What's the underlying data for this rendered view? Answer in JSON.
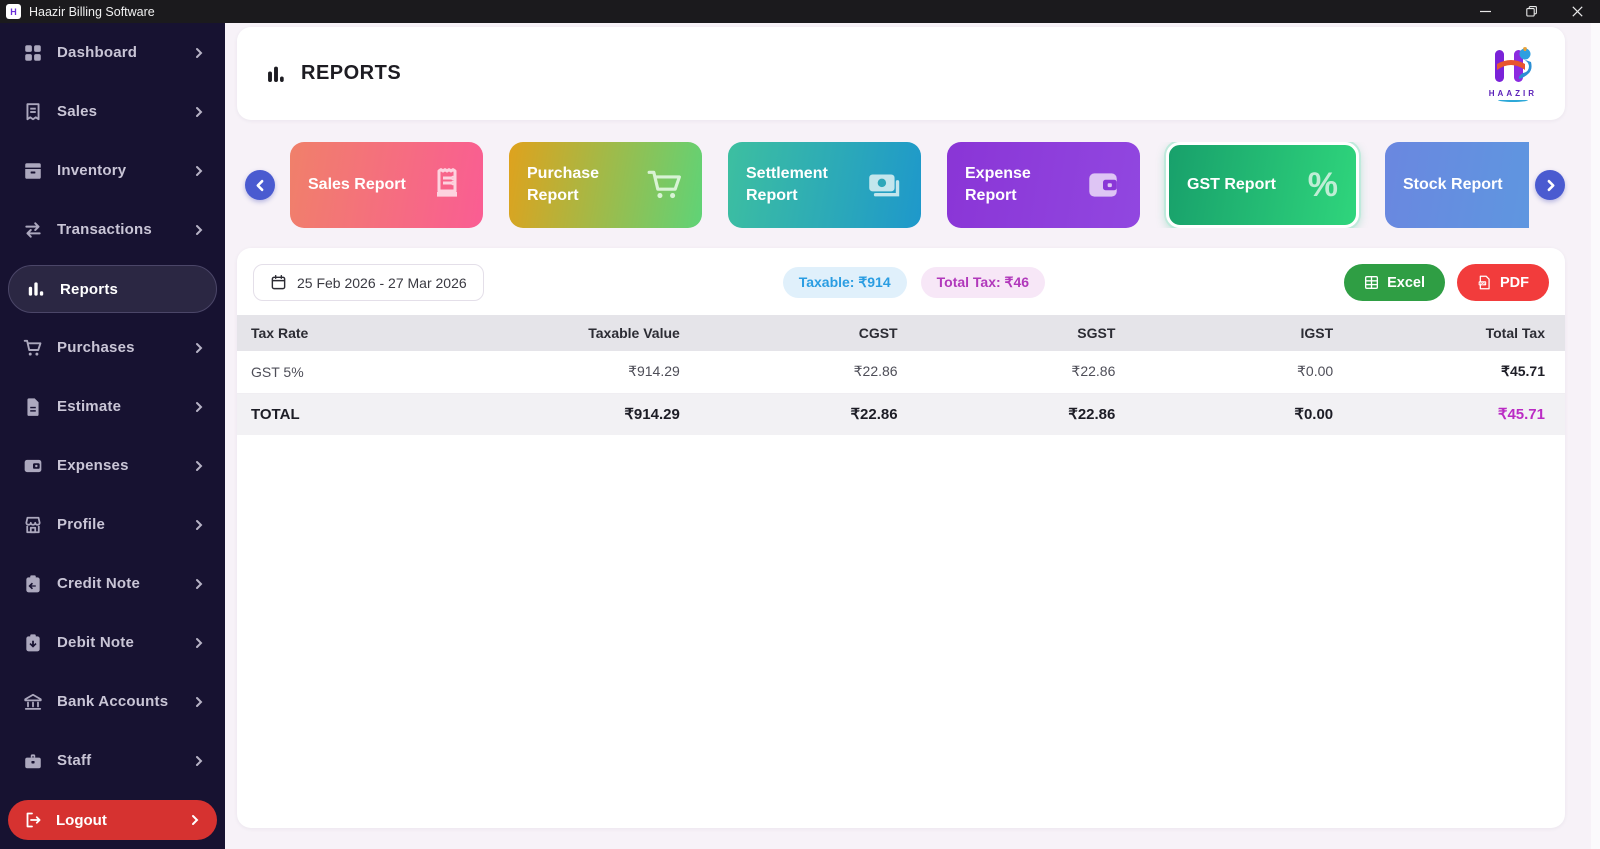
{
  "window": {
    "title": "Haazir Billing Software",
    "controls": {
      "minimize": "minimize",
      "restore": "restore",
      "close": "close"
    }
  },
  "sidebar": {
    "items": [
      {
        "label": "Dashboard",
        "icon": "grid-icon",
        "active": false
      },
      {
        "label": "Sales",
        "icon": "receipt-icon",
        "active": false
      },
      {
        "label": "Inventory",
        "icon": "box-icon",
        "active": false
      },
      {
        "label": "Transactions",
        "icon": "swap-arrows-icon",
        "active": false
      },
      {
        "label": "Reports",
        "icon": "bar-chart-icon",
        "active": true
      },
      {
        "label": "Purchases",
        "icon": "cart-icon",
        "active": false
      },
      {
        "label": "Estimate",
        "icon": "document-icon",
        "active": false
      },
      {
        "label": "Expenses",
        "icon": "wallet-icon",
        "active": false
      },
      {
        "label": "Profile",
        "icon": "storefront-icon",
        "active": false
      },
      {
        "label": "Credit Note",
        "icon": "note-return-icon",
        "active": false
      },
      {
        "label": "Debit Note",
        "icon": "note-down-icon",
        "active": false
      },
      {
        "label": "Bank Accounts",
        "icon": "bank-icon",
        "active": false
      },
      {
        "label": "Staff",
        "icon": "briefcase-icon",
        "active": false
      }
    ],
    "logout_label": "Logout"
  },
  "header": {
    "title": "REPORTS",
    "logo_word": "HAAZIR"
  },
  "carousel": {
    "cards": [
      {
        "label": "Sales Report",
        "icon": "receipt-icon",
        "colors": [
          "#f0806a",
          "#fa5d93"
        ],
        "selected": false
      },
      {
        "label": "Purchase Report",
        "icon": "cart-icon",
        "colors": [
          "#dfa21d",
          "#5fd377"
        ],
        "selected": false
      },
      {
        "label": "Settlement Report",
        "icon": "banknote-icon",
        "colors": [
          "#3dbfa0",
          "#1e98cb"
        ],
        "selected": false
      },
      {
        "label": "Expense Report",
        "icon": "wallet-icon",
        "colors": [
          "#8a35d6",
          "#9147e0"
        ],
        "selected": false
      },
      {
        "label": "GST Report",
        "icon": "percent-icon",
        "colors": [
          "#18a06b",
          "#2fd57c"
        ],
        "selected": true
      },
      {
        "label": "Stock Report",
        "icon": "box-icon",
        "colors": [
          "#6a87e0",
          "#5b9be0"
        ],
        "selected": false
      }
    ],
    "percent_glyph": "%"
  },
  "filters": {
    "date_range": "25 Feb 2026 - 27 Mar 2026",
    "badges": [
      {
        "label": "Taxable: ₹914",
        "bg": "#e0f0fb",
        "color": "#2a9de2"
      },
      {
        "label": "Total Tax: ₹46",
        "bg": "#f7e7f7",
        "color": "#b138bb"
      }
    ],
    "export": {
      "excel_label": "Excel",
      "pdf_label": "PDF"
    }
  },
  "table": {
    "columns": [
      "Tax Rate",
      "Taxable Value",
      "CGST",
      "SGST",
      "IGST",
      "Total Tax"
    ],
    "rows": [
      [
        "GST 5%",
        "₹914.29",
        "₹22.86",
        "₹22.86",
        "₹0.00",
        "₹45.71"
      ]
    ],
    "total": [
      "TOTAL",
      "₹914.29",
      "₹22.86",
      "₹22.86",
      "₹0.00",
      "₹45.71"
    ],
    "total_tax_color": "#ba2bc4"
  }
}
